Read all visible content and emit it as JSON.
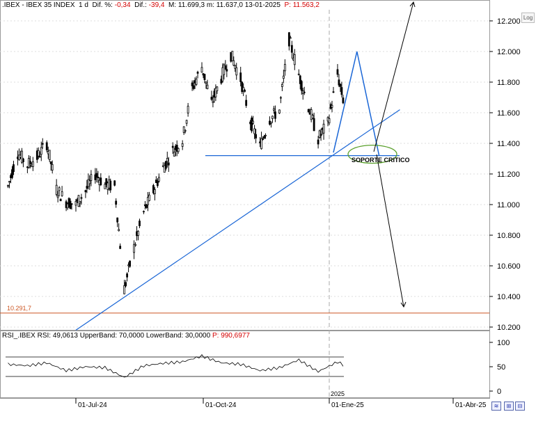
{
  "header": {
    "symbol": ".IBEX - IBEX 35 INDEX",
    "timeframe": "1 d",
    "dif_pct_label": "Dif. %:",
    "dif_pct_value": "-0,34",
    "dif_label": "Dif.:",
    "dif_value": "-39,4",
    "m_label": "M:",
    "m_value": "11.699,3",
    "m2_label": "m:",
    "m2_value": "11.637,0",
    "date": "13-01-2025",
    "p_label": "P:",
    "p_value": "11.563,2"
  },
  "rsi_header": {
    "name": "RSI_.IBEX",
    "rsi_label": "RSI:",
    "rsi_value": "49,0613",
    "upper_label": "UpperBand:",
    "upper_value": "70,0000",
    "lower_label": "LowerBand:",
    "lower_value": "30,0000",
    "p_label": "P:",
    "p_value": "990,6977"
  },
  "log_button": "Log",
  "controls": [
    "≋",
    "⊞",
    "⊟"
  ],
  "annotations": {
    "support_label": "SOPORTE CRITICO",
    "level_label": "10.291,7"
  },
  "colors": {
    "candle": "#000000",
    "trendline": "#1a66d6",
    "support_ellipse": "#5aa02c",
    "level_line": "#cc5522",
    "rsi_line": "#000000",
    "rsi_over": "#c000c0",
    "grid": "#dddddd"
  },
  "chart_data": [
    {
      "type": "candlestick",
      "title": "",
      "ylim": [
        10200,
        12300
      ],
      "y_ticks": [
        "12.200",
        "12.000",
        "11.800",
        "11.600",
        "11.400",
        "11.200",
        "11.000",
        "10.800",
        "10.600",
        "10.400",
        "10.200"
      ],
      "x_ticks": [
        "01-Jul-24",
        "01-Oct-24",
        "01-Ene-25",
        "01-Abr-25"
      ],
      "year_marker": "2025",
      "close_series": [
        {
          "date": "2024-05-13",
          "close": 11120
        },
        {
          "date": "2024-05-20",
          "close": 11340
        },
        {
          "date": "2024-05-27",
          "close": 11260
        },
        {
          "date": "2024-06-03",
          "close": 11310
        },
        {
          "date": "2024-06-10",
          "close": 11400
        },
        {
          "date": "2024-06-17",
          "close": 11100
        },
        {
          "date": "2024-06-24",
          "close": 11020
        },
        {
          "date": "2024-07-01",
          "close": 11000
        },
        {
          "date": "2024-07-08",
          "close": 11090
        },
        {
          "date": "2024-07-15",
          "close": 11200
        },
        {
          "date": "2024-07-22",
          "close": 11130
        },
        {
          "date": "2024-07-29",
          "close": 11120
        },
        {
          "date": "2024-08-05",
          "close": 10450
        },
        {
          "date": "2024-08-12",
          "close": 10720
        },
        {
          "date": "2024-08-19",
          "close": 10950
        },
        {
          "date": "2024-08-26",
          "close": 11090
        },
        {
          "date": "2024-09-02",
          "close": 11240
        },
        {
          "date": "2024-09-09",
          "close": 11350
        },
        {
          "date": "2024-09-16",
          "close": 11420
        },
        {
          "date": "2024-09-23",
          "close": 11760
        },
        {
          "date": "2024-09-30",
          "close": 11900
        },
        {
          "date": "2024-10-07",
          "close": 11660
        },
        {
          "date": "2024-10-14",
          "close": 11830
        },
        {
          "date": "2024-10-21",
          "close": 11980
        },
        {
          "date": "2024-10-28",
          "close": 11820
        },
        {
          "date": "2024-11-04",
          "close": 11550
        },
        {
          "date": "2024-11-11",
          "close": 11380
        },
        {
          "date": "2024-11-18",
          "close": 11560
        },
        {
          "date": "2024-11-25",
          "close": 11620
        },
        {
          "date": "2024-12-02",
          "close": 12080
        },
        {
          "date": "2024-12-09",
          "close": 11850
        },
        {
          "date": "2024-12-16",
          "close": 11640
        },
        {
          "date": "2024-12-23",
          "close": 11430
        },
        {
          "date": "2024-12-30",
          "close": 11530
        },
        {
          "date": "2025-01-06",
          "close": 11850
        },
        {
          "date": "2025-01-13",
          "close": 11563.2
        }
      ],
      "support_level": 11320,
      "reference_level": 10291.7,
      "trendline": [
        {
          "date": "2024-07-01",
          "value": 10180
        },
        {
          "date": "2025-02-20",
          "value": 11620
        }
      ],
      "projection": [
        {
          "date": "2025-01-03",
          "value": 11340
        },
        {
          "date": "2025-01-20",
          "value": 12000
        },
        {
          "date": "2025-02-05",
          "value": 11320
        }
      ]
    },
    {
      "type": "line",
      "title": "",
      "ylim": [
        0,
        100
      ],
      "y_ticks": [
        "100",
        "50",
        "0"
      ],
      "upper_band": 70,
      "lower_band": 30,
      "rsi_series": [
        {
          "date": "2024-05-13",
          "rsi": 55
        },
        {
          "date": "2024-05-27",
          "rsi": 52
        },
        {
          "date": "2024-06-10",
          "rsi": 58
        },
        {
          "date": "2024-06-24",
          "rsi": 42
        },
        {
          "date": "2024-07-08",
          "rsi": 50
        },
        {
          "date": "2024-07-22",
          "rsi": 48
        },
        {
          "date": "2024-08-05",
          "rsi": 28
        },
        {
          "date": "2024-08-19",
          "rsi": 52
        },
        {
          "date": "2024-09-02",
          "rsi": 57
        },
        {
          "date": "2024-09-16",
          "rsi": 60
        },
        {
          "date": "2024-09-30",
          "rsi": 72
        },
        {
          "date": "2024-10-14",
          "rsi": 58
        },
        {
          "date": "2024-10-28",
          "rsi": 55
        },
        {
          "date": "2024-11-11",
          "rsi": 42
        },
        {
          "date": "2024-11-25",
          "rsi": 48
        },
        {
          "date": "2024-12-09",
          "rsi": 64
        },
        {
          "date": "2024-12-23",
          "rsi": 40
        },
        {
          "date": "2025-01-06",
          "rsi": 60
        },
        {
          "date": "2025-01-13",
          "rsi": 49.06
        }
      ]
    }
  ]
}
